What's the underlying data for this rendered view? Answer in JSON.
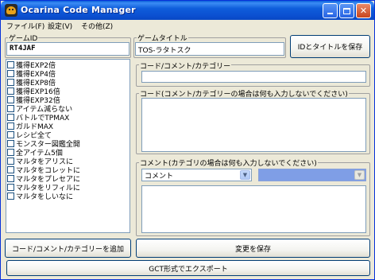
{
  "window": {
    "title": "Ocarina Code Manager"
  },
  "menu": [
    "ファイル(F)",
    "設定(V)",
    "その他(Z)"
  ],
  "game_id": {
    "label": "ゲームID",
    "value": "RT4JAF"
  },
  "game_title": {
    "label": "ゲームタイトル",
    "value": "TOS-ラタトスク"
  },
  "save_id_title_button": "IDとタイトルを保存",
  "code_list": [
    "獲得EXP2倍",
    "獲得EXP4倍",
    "獲得EXP8倍",
    "獲得EXP16倍",
    "獲得EXP32倍",
    "アイテム減らない",
    "バトルでTPMAX",
    "ガルドMAX",
    "レシピ全て",
    "モンスター図鑑全開",
    "全アイテム5個",
    "マルタをアリスに",
    "マルタをコレットに",
    "マルタをプレセアに",
    "マルタをリフィルに",
    "マルタをしいなに"
  ],
  "code_name_group": {
    "label": "コード/コメント/カテゴリー",
    "value": ""
  },
  "code_body_group": {
    "label": "コード(コメント/カテゴリーの場合は何も入力しないでください)"
  },
  "comment_group": {
    "label": "コメント(カテゴリの場合は何も入力しないでください)",
    "type_select": "コメント",
    "category_select": ""
  },
  "add_button": "コード/コメント/カテゴリーを追加",
  "save_changes_button": "変更を保存",
  "export_gct_button": "GCT形式でエクスポート"
}
